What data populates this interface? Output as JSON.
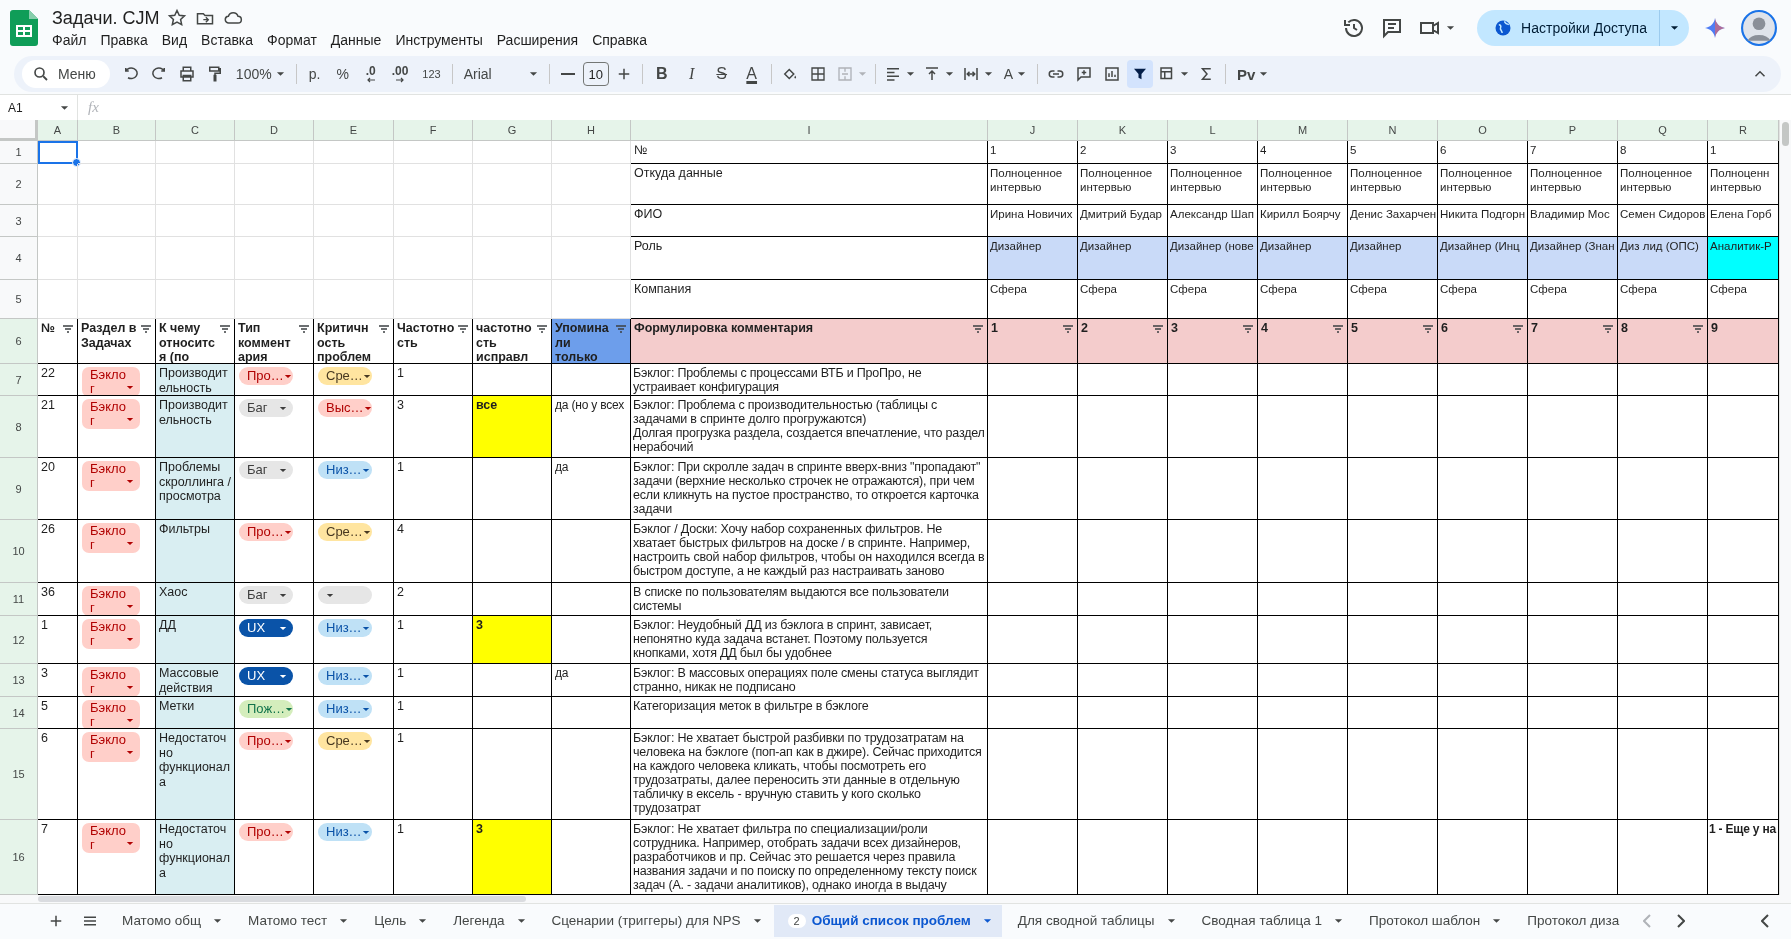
{
  "doc": {
    "title": "Задачи. CJM",
    "menu": [
      "Файл",
      "Правка",
      "Вид",
      "Вставка",
      "Формат",
      "Данные",
      "Инструменты",
      "Расширения",
      "Справка"
    ]
  },
  "share": {
    "label": "Настройки Доступа"
  },
  "toolbar": {
    "search_placeholder": "Меню",
    "zoom": "100%",
    "currency": "р.",
    "percent": "%",
    "decrease_decimals": ".0",
    "increase_decimals": ".00",
    "number_format": "123",
    "font": "Arial",
    "font_size": "10",
    "bold": "B",
    "italic": "I",
    "strike": "S",
    "text_color": "A",
    "rotate": "A",
    "input_tools": "Pv",
    "filter_on": true
  },
  "formula_bar": {
    "cell": "A1",
    "fx": "fx"
  },
  "columns": [
    "A",
    "B",
    "C",
    "D",
    "E",
    "F",
    "G",
    "H",
    "I",
    "J",
    "K",
    "L",
    "M",
    "N",
    "O",
    "P",
    "Q",
    "R"
  ],
  "info_rows": [
    {
      "row": "1",
      "a_cell_selected": true,
      "label": "№",
      "values": [
        {
          "text": "1"
        },
        {
          "text": "2"
        },
        {
          "text": "3"
        },
        {
          "text": "4"
        },
        {
          "text": "5"
        },
        {
          "text": "6"
        },
        {
          "text": "7"
        },
        {
          "text": "8"
        },
        {
          "text": "1"
        }
      ]
    },
    {
      "row": "2",
      "a_cell_selected": false,
      "label": "Откуда данные",
      "values": [
        {
          "text": "Полноценное интервью"
        },
        {
          "text": "Полноценное интервью"
        },
        {
          "text": "Полноценное интервью"
        },
        {
          "text": "Полноценное интервью"
        },
        {
          "text": "Полноценное интервью"
        },
        {
          "text": "Полноценное интервью"
        },
        {
          "text": "Полноценное интервью"
        },
        {
          "text": "Полноценное интервью"
        },
        {
          "text": "Полноценн интервью"
        }
      ]
    },
    {
      "row": "3",
      "a_cell_selected": false,
      "label": "ФИО",
      "values": [
        {
          "text": "Ирина Новичих"
        },
        {
          "text": "Дмитрий Будар"
        },
        {
          "text": "Александр Шап"
        },
        {
          "text": "Кирилл Боярчу"
        },
        {
          "text": "Денис Захарчен"
        },
        {
          "text": "Никита Подгорн"
        },
        {
          "text": "Владимир Мос"
        },
        {
          "text": "Семен Сидоров"
        },
        {
          "text": "Елена Горб"
        }
      ]
    },
    {
      "row": "4",
      "a_cell_selected": false,
      "label": "Роль",
      "values": [
        {
          "text": "Дизайнер",
          "color": "#c9daf8"
        },
        {
          "text": "Дизайнер",
          "color": "#c9daf8"
        },
        {
          "text": "Дизайнер (нове",
          "color": "#c9daf8"
        },
        {
          "text": "Дизайнер",
          "color": "#c9daf8"
        },
        {
          "text": "Дизайнер",
          "color": "#c9daf8"
        },
        {
          "text": "Дизайнер (Инц",
          "color": "#c9daf8"
        },
        {
          "text": "Дизайнер (Знан",
          "color": "#c9daf8"
        },
        {
          "text": "Диз лид (ОПС)",
          "color": "#c9daf8"
        },
        {
          "text": "Аналитик-Р",
          "color": "#00ffff"
        }
      ]
    },
    {
      "row": "5",
      "a_cell_selected": false,
      "label": "Компания",
      "values": [
        {
          "text": "Сфера"
        },
        {
          "text": "Сфера"
        },
        {
          "text": "Сфера"
        },
        {
          "text": "Сфера"
        },
        {
          "text": "Сфера"
        },
        {
          "text": "Сфера"
        },
        {
          "text": "Сфера"
        },
        {
          "text": "Сфера"
        },
        {
          "text": "Сфера"
        }
      ]
    }
  ],
  "header": {
    "row": "6",
    "cells": [
      {
        "text": "№",
        "filter": true
      },
      {
        "text": "Раздел в Задачах",
        "filter": true
      },
      {
        "text": "К чему относится (по",
        "filter": true
      },
      {
        "text": "Тип комментария",
        "filter": true
      },
      {
        "text": "Критичность проблем",
        "filter": true
      },
      {
        "text": "Частотность",
        "filter": true
      },
      {
        "text": "частотность исправл",
        "filter": true
      },
      {
        "text": "Упоминали только",
        "filter": true,
        "color": "#6d9eeb"
      },
      {
        "text": "Формулировка комментария",
        "filter": true,
        "color": "#f4cccc"
      },
      {
        "text": "1",
        "filter": true,
        "color": "#f4cccc"
      },
      {
        "text": "2",
        "filter": true,
        "color": "#f4cccc"
      },
      {
        "text": "3",
        "filter": true,
        "color": "#f4cccc"
      },
      {
        "text": "4",
        "filter": true,
        "color": "#f4cccc"
      },
      {
        "text": "5",
        "filter": true,
        "color": "#f4cccc"
      },
      {
        "text": "6",
        "filter": true,
        "color": "#f4cccc"
      },
      {
        "text": "7",
        "filter": true,
        "color": "#f4cccc"
      },
      {
        "text": "8",
        "filter": true,
        "color": "#f4cccc"
      },
      {
        "text": "9",
        "filter": false,
        "color": "#f4cccc"
      }
    ]
  },
  "rows": [
    {
      "row": "7",
      "num": "22",
      "section": {
        "text": "Бэклог",
        "color": "#ffcfc9"
      },
      "topic": "Производительность",
      "type": {
        "text": "Про…",
        "color": "#ffcfc9"
      },
      "severity": {
        "text": "Сре…",
        "color": "#ffe5a0"
      },
      "frequency": "1",
      "comment": "Бэклог: Проблемы с процессами ВТБ и ПроПро, не устраивает конфигурация"
    },
    {
      "row": "8",
      "num": "21",
      "section": {
        "text": "Бэклог",
        "color": "#ffcfc9"
      },
      "topic": "Производительность",
      "type": {
        "text": "Баг",
        "color": "#e6e6e6"
      },
      "severity": {
        "text": "Выс…",
        "color": "#ffcfc9"
      },
      "frequency": "3",
      "fixed": {
        "text": "все",
        "color": "#ffff00"
      },
      "mentioned": "да (но у всех",
      "comment": "Бэклог: Проблема с производительностью (таблицы с задачами в спринте долго прогружаются)\nДолгая прогрузка раздела, создается впечатление, что раздел нерабочий"
    },
    {
      "row": "9",
      "num": "20",
      "section": {
        "text": "Бэклог",
        "color": "#ffcfc9"
      },
      "topic": "Проблемы скроллинга / просмотра",
      "type": {
        "text": "Баг",
        "color": "#e6e6e6"
      },
      "severity": {
        "text": "Низ…",
        "color": "#bfe1f6"
      },
      "frequency": "1",
      "mentioned": "да",
      "comment": "Бэклог: При скролле задач в спринте вверх-вниз \"пропадают\" задачи (верхние несколько строчек не отражаются), при чем если кликнуть на пустое пространство, то откроется карточка задачи"
    },
    {
      "row": "10",
      "num": "26",
      "section": {
        "text": "Бэклог",
        "color": "#ffcfc9"
      },
      "topic": "Фильтры",
      "type": {
        "text": "Про…",
        "color": "#ffcfc9"
      },
      "severity": {
        "text": "Сре…",
        "color": "#ffe5a0"
      },
      "frequency": "4",
      "comment": "Бэклог / Доски: Хочу набор сохраненных фильтров. Не хватает быстрых фильтров на доске / в спринте. Например, настроить свой набор фильтров, чтобы он находился всегда в быстром доступе, а не каждый раз настраивать заново"
    },
    {
      "row": "11",
      "num": "36",
      "section": {
        "text": "Бэклог",
        "color": "#ffcfc9"
      },
      "topic": "Хаос",
      "type": {
        "text": "Баг",
        "color": "#e6e6e6"
      },
      "severity": {
        "color": "#e6e6e6"
      },
      "frequency": "2",
      "comment": "В списке по пользователям выдаются все пользователи системы"
    },
    {
      "row": "12",
      "num": "1",
      "section": {
        "text": "Бэклог",
        "color": "#ffcfc9"
      },
      "topic": "ДД",
      "type": {
        "text": "UX",
        "color": "#0a53a8"
      },
      "severity": {
        "text": "Низ…",
        "color": "#bfe1f6"
      },
      "frequency": "1",
      "fixed": {
        "text": "3",
        "color": "#ffff00"
      },
      "comment": "Бэклог: Неудобный ДД из бэклога в спринт, зависает, непонятно куда задача встанет. Поэтому пользуется кнопками, хотя ДД был бы удобнее"
    },
    {
      "row": "13",
      "num": "3",
      "section": {
        "text": "Бэклог",
        "color": "#ffcfc9"
      },
      "topic": "Массовые действия",
      "type": {
        "text": "UX",
        "color": "#0a53a8"
      },
      "severity": {
        "text": "Низ…",
        "color": "#bfe1f6"
      },
      "frequency": "1",
      "mentioned": "да",
      "comment": "Бэклог: В массовых операциях поле смены статуса выглядит странно, никак не подписано"
    },
    {
      "row": "14",
      "num": "5",
      "section": {
        "text": "Бэклог",
        "color": "#ffcfc9"
      },
      "topic": "Метки",
      "type": {
        "text": "Пож…",
        "color": "#d4edbc"
      },
      "severity": {
        "text": "Низ…",
        "color": "#bfe1f6"
      },
      "frequency": "1",
      "comment": "Категоризация меток в фильтре в бэклоге"
    },
    {
      "row": "15",
      "num": "6",
      "section": {
        "text": "Бэклог",
        "color": "#ffcfc9"
      },
      "topic": "Недостаточно функционала",
      "type": {
        "text": "Про…",
        "color": "#ffcfc9"
      },
      "severity": {
        "text": "Сре…",
        "color": "#ffe5a0"
      },
      "frequency": "1",
      "comment": "Бэклог: Не хватает быстрой разбивки по трудозатратам на человека на бэклоге (поп-ап как в джире). Сейчас приходится на каждого человека кликать, чтобы посмотреть его трудозатраты, далее переносить эти данные в отдельную табличку в ексель - вручную ставить у кого сколько трудозатрат"
    },
    {
      "row": "16",
      "num": "7",
      "section": {
        "text": "Бэклог",
        "color": "#ffcfc9"
      },
      "topic": "Недостаточно функционала",
      "type": {
        "text": "Про…",
        "color": "#ffcfc9"
      },
      "severity": {
        "text": "Низ…",
        "color": "#bfe1f6"
      },
      "frequency": "1",
      "fixed": {
        "text": "3",
        "color": "#ffff00"
      },
      "comment": "Бэклог: Не хватает фильтра по специализации/роли сотрудника. Например, отобрать задачи всех дизайнеров, разработчиков и пр. Сейчас это решается через правила названия задачи и по поиску по определенному тексту поиск задач (А. - задачи аналитиков), однако иногда в выдачу",
      "note": "1 - Еще у на"
    }
  ],
  "sheet_tabs": [
    {
      "label": "Матомо общ",
      "selected": false,
      "cut": false
    },
    {
      "label": "Матомо тест",
      "selected": false,
      "cut": false
    },
    {
      "label": "Цель",
      "selected": false,
      "cut": false
    },
    {
      "label": "Легенда",
      "selected": false,
      "cut": false
    },
    {
      "label": "Сценарии (триггеры) для NPS",
      "selected": false,
      "cut": false
    },
    {
      "label": "Общий список проблем",
      "selected": true,
      "badge": "2",
      "cut": false
    },
    {
      "label": "Для сводной таблицы",
      "selected": false,
      "cut": false
    },
    {
      "label": "Сводная таблица 1",
      "selected": false,
      "cut": false
    },
    {
      "label": "Протокол шаблон",
      "selected": false,
      "cut": false
    },
    {
      "label": "Протокол диза",
      "selected": false,
      "cut": true
    }
  ]
}
